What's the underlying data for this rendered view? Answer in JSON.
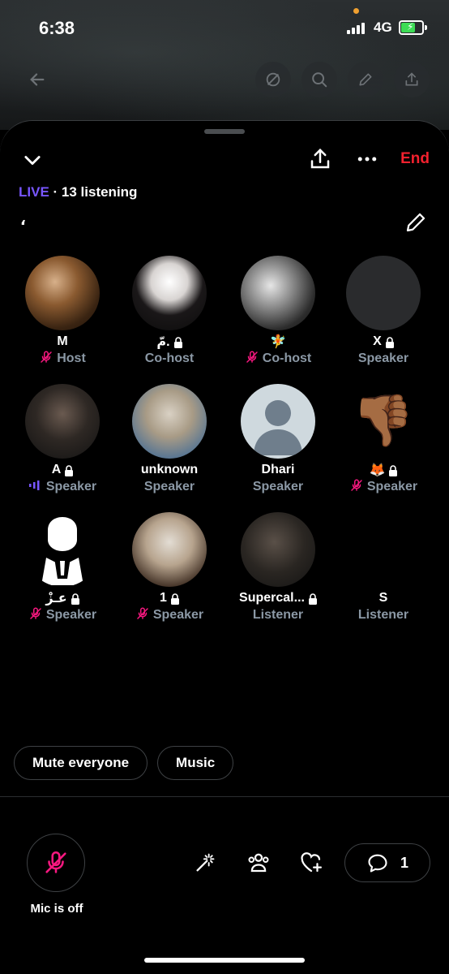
{
  "status_bar": {
    "time": "6:38",
    "network": "4G"
  },
  "space": {
    "live_label": "LIVE",
    "listening": " · 13 listening",
    "title": "،",
    "end_label": "End"
  },
  "participants": [
    {
      "name": "M",
      "role": "Host",
      "muted": true,
      "locked": false
    },
    {
      "name": "مّ.",
      "role": "Co-host",
      "muted": false,
      "locked": true
    },
    {
      "name": "🧚",
      "role": "Co-host",
      "muted": true,
      "locked": false
    },
    {
      "name": "X",
      "role": "Speaker",
      "muted": false,
      "locked": true
    },
    {
      "name": "A",
      "role": "Speaker",
      "muted": false,
      "locked": true,
      "speaking": true
    },
    {
      "name": "unknown",
      "role": "Speaker",
      "muted": false,
      "locked": false
    },
    {
      "name": "Dhari",
      "role": "Speaker",
      "muted": false,
      "locked": false
    },
    {
      "name": "🦊",
      "role": "Speaker",
      "muted": true,
      "locked": true
    },
    {
      "name": "عـزْ",
      "role": "Speaker",
      "muted": true,
      "locked": true
    },
    {
      "name": "1",
      "role": "Speaker",
      "muted": true,
      "locked": true
    },
    {
      "name": "Supercal...",
      "role": "Listener",
      "muted": false,
      "locked": true
    },
    {
      "name": "S",
      "role": "Listener",
      "muted": false,
      "locked": false
    }
  ],
  "actions": {
    "mute_everyone": "Mute everyone",
    "music": "Music"
  },
  "mic": {
    "label": "Mic is off"
  },
  "chat": {
    "count": "1"
  },
  "colors": {
    "live": "#7856ff",
    "end": "#f4212e",
    "muted": "#f91880",
    "role": "#8b98a5"
  }
}
